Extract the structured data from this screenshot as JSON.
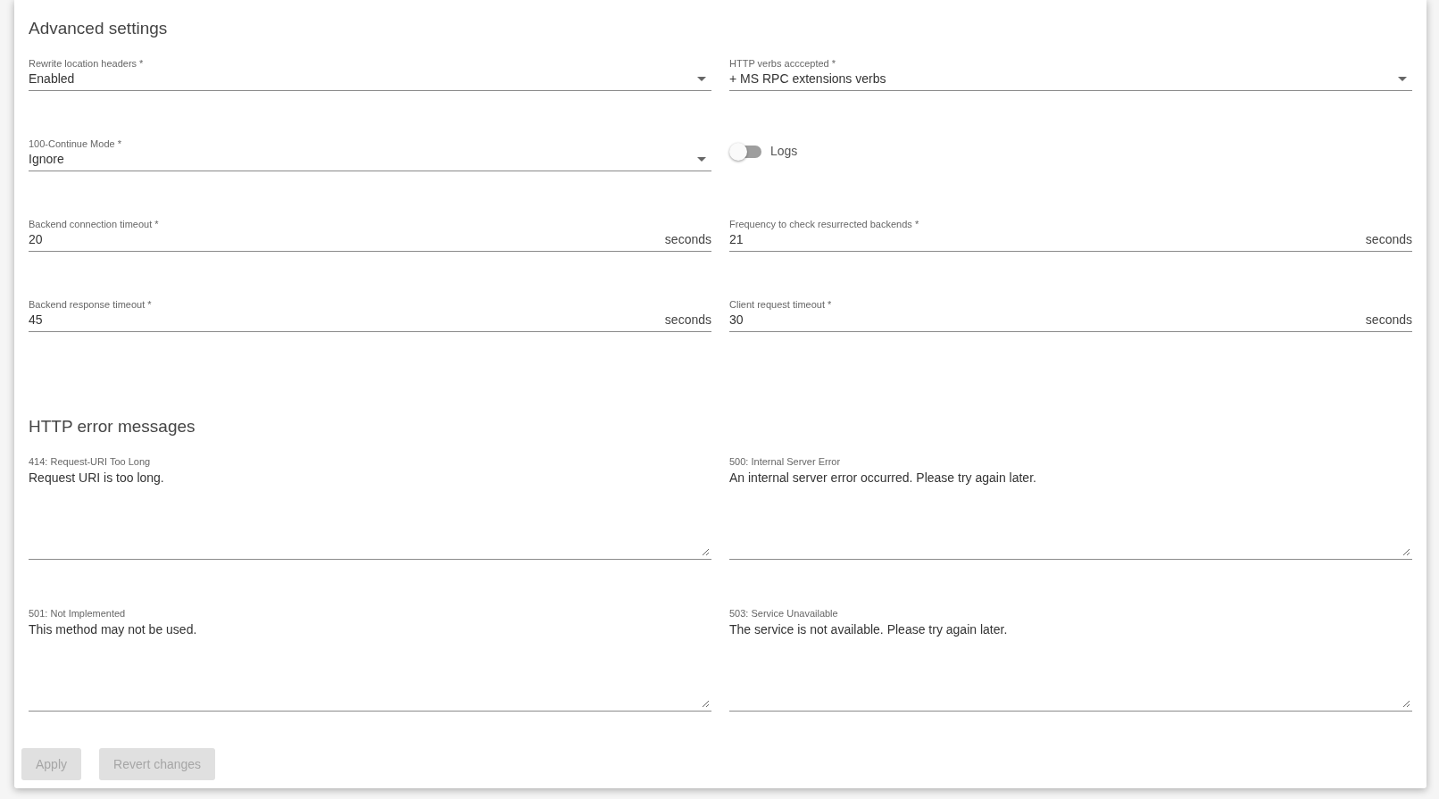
{
  "sections": [
    {
      "title": "Advanced settings",
      "fields": [
        {
          "kind": "select",
          "label": "Rewrite location headers *",
          "value": "Enabled"
        },
        {
          "kind": "select",
          "label": "HTTP verbs acccepted *",
          "value": "+ MS RPC extensions verbs"
        },
        {
          "kind": "select",
          "label": "100-Continue Mode *",
          "value": "Ignore"
        },
        {
          "kind": "toggle",
          "label": "Logs",
          "on": false
        },
        {
          "kind": "number",
          "label": "Backend connection timeout *",
          "value": "20",
          "suffix": "seconds"
        },
        {
          "kind": "number",
          "label": "Frequency to check resurrected backends *",
          "value": "21",
          "suffix": "seconds"
        },
        {
          "kind": "number",
          "label": "Backend response timeout *",
          "value": "45",
          "suffix": "seconds"
        },
        {
          "kind": "number",
          "label": "Client request timeout *",
          "value": "30",
          "suffix": "seconds"
        }
      ]
    },
    {
      "title": "HTTP error messages",
      "fields": [
        {
          "kind": "textarea",
          "label": "414: Request-URI Too Long",
          "value": "Request URI is too long."
        },
        {
          "kind": "textarea",
          "label": "500: Internal Server Error",
          "value": "An internal server error occurred. Please try again later."
        },
        {
          "kind": "textarea",
          "label": "501: Not Implemented",
          "value": "This method may not be used."
        },
        {
          "kind": "textarea",
          "label": "503: Service Unavailable",
          "value": "The service is not available. Please try again later."
        }
      ]
    }
  ],
  "buttons": [
    {
      "label": "Apply",
      "disabled": true
    },
    {
      "label": "Revert changes",
      "disabled": true
    }
  ]
}
